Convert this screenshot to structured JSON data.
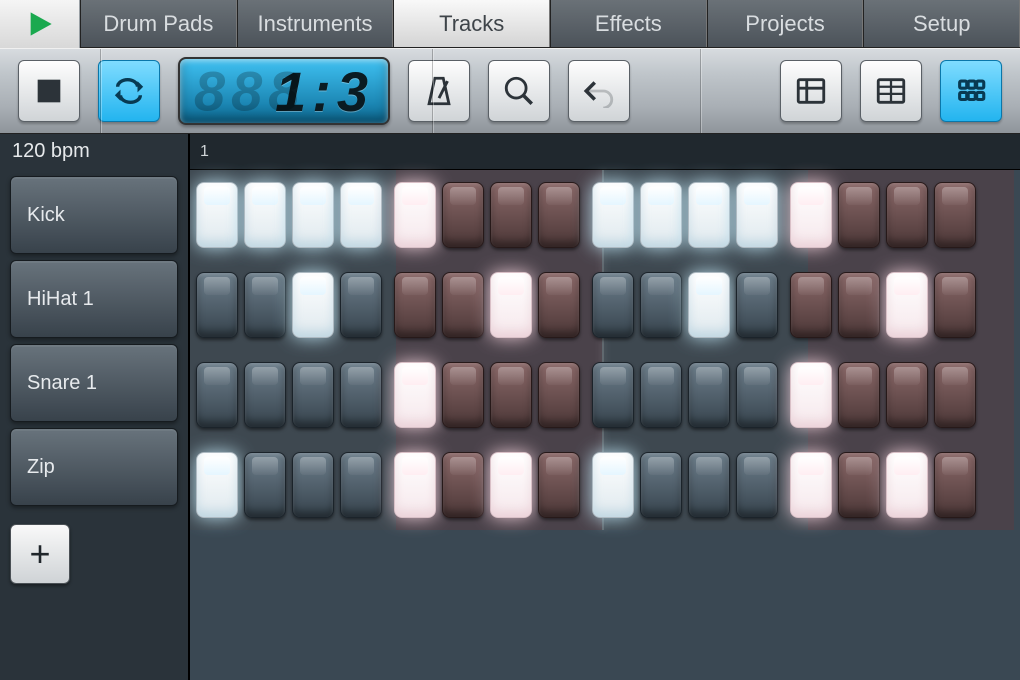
{
  "tabs": {
    "items": [
      "Drum Pads",
      "Instruments",
      "Tracks",
      "Effects",
      "Projects",
      "Setup"
    ],
    "active_index": 2
  },
  "toolbar": {
    "play_icon": "play-icon",
    "stop_icon": "stop-icon",
    "loop_icon": "loop-icon",
    "loop_active": true,
    "lcd_ghost": "888",
    "lcd_value": "1:3",
    "metronome_icon": "metronome-icon",
    "zoom_icon": "search-icon",
    "undo_icon": "undo-icon",
    "view_playlist_icon": "playlist-view-icon",
    "view_piano_icon": "pianoroll-view-icon",
    "view_step_icon": "stepseq-view-icon",
    "view_step_active": true
  },
  "transport": {
    "bpm_label": "120 bpm",
    "ruler_start": "1"
  },
  "channels": [
    {
      "name": "Kick",
      "steps": [
        1,
        1,
        1,
        1,
        1,
        0,
        0,
        0,
        1,
        1,
        1,
        1,
        1,
        0,
        0,
        0
      ]
    },
    {
      "name": "HiHat 1",
      "steps": [
        0,
        0,
        1,
        0,
        0,
        0,
        1,
        0,
        0,
        0,
        1,
        0,
        0,
        0,
        1,
        0
      ]
    },
    {
      "name": "Snare 1",
      "steps": [
        0,
        0,
        0,
        0,
        1,
        0,
        0,
        0,
        0,
        0,
        0,
        0,
        1,
        0,
        0,
        0
      ]
    },
    {
      "name": "Zip",
      "steps": [
        1,
        0,
        0,
        0,
        1,
        0,
        1,
        0,
        1,
        0,
        0,
        0,
        1,
        0,
        1,
        0
      ]
    }
  ],
  "add_channel_label": "+",
  "step_colors": {
    "group_a": "blue",
    "group_b": "red"
  }
}
